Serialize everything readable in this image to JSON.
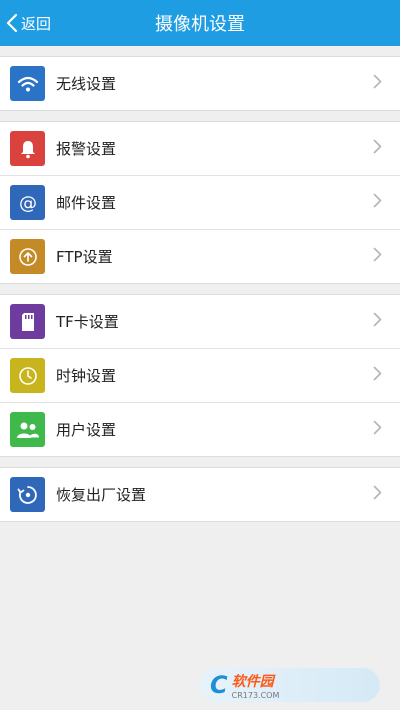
{
  "header": {
    "back_label": "返回",
    "title": "摄像机设置"
  },
  "groups": [
    {
      "items": [
        {
          "label": "无线设置",
          "icon": "wifi-icon",
          "color": "#2b73c6"
        }
      ]
    },
    {
      "items": [
        {
          "label": "报警设置",
          "icon": "bell-icon",
          "color": "#d9423d"
        },
        {
          "label": "邮件设置",
          "icon": "at-icon",
          "color": "#2f68b8"
        },
        {
          "label": "FTP设置",
          "icon": "upload-icon",
          "color": "#c38a26"
        }
      ]
    },
    {
      "items": [
        {
          "label": "TF卡设置",
          "icon": "sd-card-icon",
          "color": "#6e3b9e"
        },
        {
          "label": "时钟设置",
          "icon": "clock-icon",
          "color": "#c8b51e"
        },
        {
          "label": "用户设置",
          "icon": "users-icon",
          "color": "#3fb84c"
        }
      ]
    },
    {
      "items": [
        {
          "label": "恢复出厂设置",
          "icon": "restore-icon",
          "color": "#2f68b8"
        }
      ]
    }
  ],
  "watermark": {
    "cn": "软件园",
    "en": "CR173.COM"
  }
}
